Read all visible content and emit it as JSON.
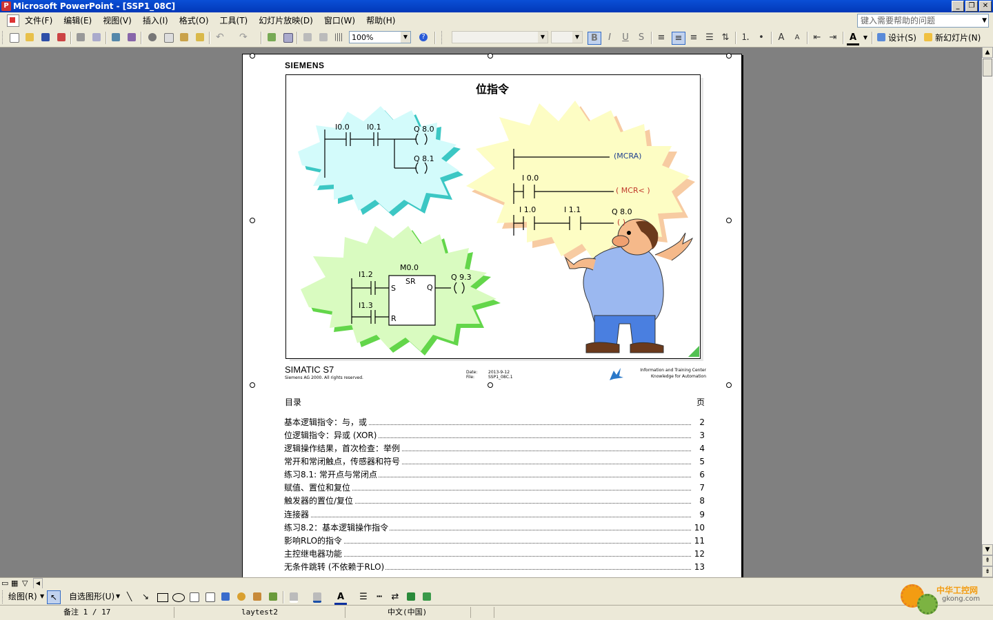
{
  "window": {
    "title": "Microsoft PowerPoint - [SSP1_08C]"
  },
  "menu": [
    "文件(F)",
    "编辑(E)",
    "视图(V)",
    "插入(I)",
    "格式(O)",
    "工具(T)",
    "幻灯片放映(D)",
    "窗口(W)",
    "帮助(H)"
  ],
  "help_box": {
    "placeholder": "键入需要帮助的问题"
  },
  "toolbar": {
    "zoom": "100%",
    "design_label": "设计(S)",
    "new_slide_label": "新幻灯片(N)"
  },
  "slide": {
    "brand": "SIEMENS",
    "title": "位指令",
    "footer_product": "SIMATIC S7",
    "footer_copyright": "Siemens AG 2000. All rights reserved.",
    "date_label": "Date:",
    "date_value": "2013-9-12",
    "file_label": "File:",
    "file_value": "SSP1_08C.1",
    "itc_line1": "Information and Training Center",
    "itc_line2": "Knowledge for Automation",
    "ladder1": {
      "c1": "I0.0",
      "c2": "I0.1",
      "o1": "Q 8.0",
      "o2": "Q 8.1"
    },
    "ladder2": {
      "mcra": "(MCRA)",
      "c1": "I 0.0",
      "mcr": "( MCR< )",
      "c2": "I 1.0",
      "c3": "I 1.1",
      "o1": "Q 8.0",
      "coil": "( )"
    },
    "ladder3": {
      "c1": "I1.2",
      "c2": "I1.3",
      "block": "M0.0",
      "sr": "SR",
      "s": "S",
      "r": "R",
      "q": "Q",
      "o1": "Q 9.3"
    }
  },
  "toc": {
    "header": "目录",
    "page_header": "页",
    "rows": [
      {
        "title": "基本逻辑指令：与，或",
        "page": "2"
      },
      {
        "title": "位逻辑指令：异或 (XOR)",
        "page": "3"
      },
      {
        "title": "逻辑操作结果，首次检查：举例",
        "page": "4"
      },
      {
        "title": "常开和常闭触点，传感器和符号",
        "page": "5"
      },
      {
        "title": "练习8.1: 常开点与常闭点",
        "page": "6"
      },
      {
        "title": "赋值、置位和复位",
        "page": "7"
      },
      {
        "title": "触发器的置位/复位",
        "page": "8"
      },
      {
        "title": "连接器",
        "page": "9"
      },
      {
        "title": "练习8.2：基本逻辑操作指令",
        "page": "10"
      },
      {
        "title": "影响RLO的指令",
        "page": "11"
      },
      {
        "title": "主控继电器功能",
        "page": "12"
      },
      {
        "title": "无条件跳转 (不依赖于RLO)",
        "page": "13"
      }
    ]
  },
  "drawbar": {
    "draw_label": "绘图(R)",
    "autoshape_label": "自选图形(U)"
  },
  "status": {
    "notes": "备注 1 / 17",
    "design": "laytest2",
    "language": "中文(中国)"
  },
  "watermark": {
    "text1": "中华工控网",
    "text2": "gkong.com"
  }
}
